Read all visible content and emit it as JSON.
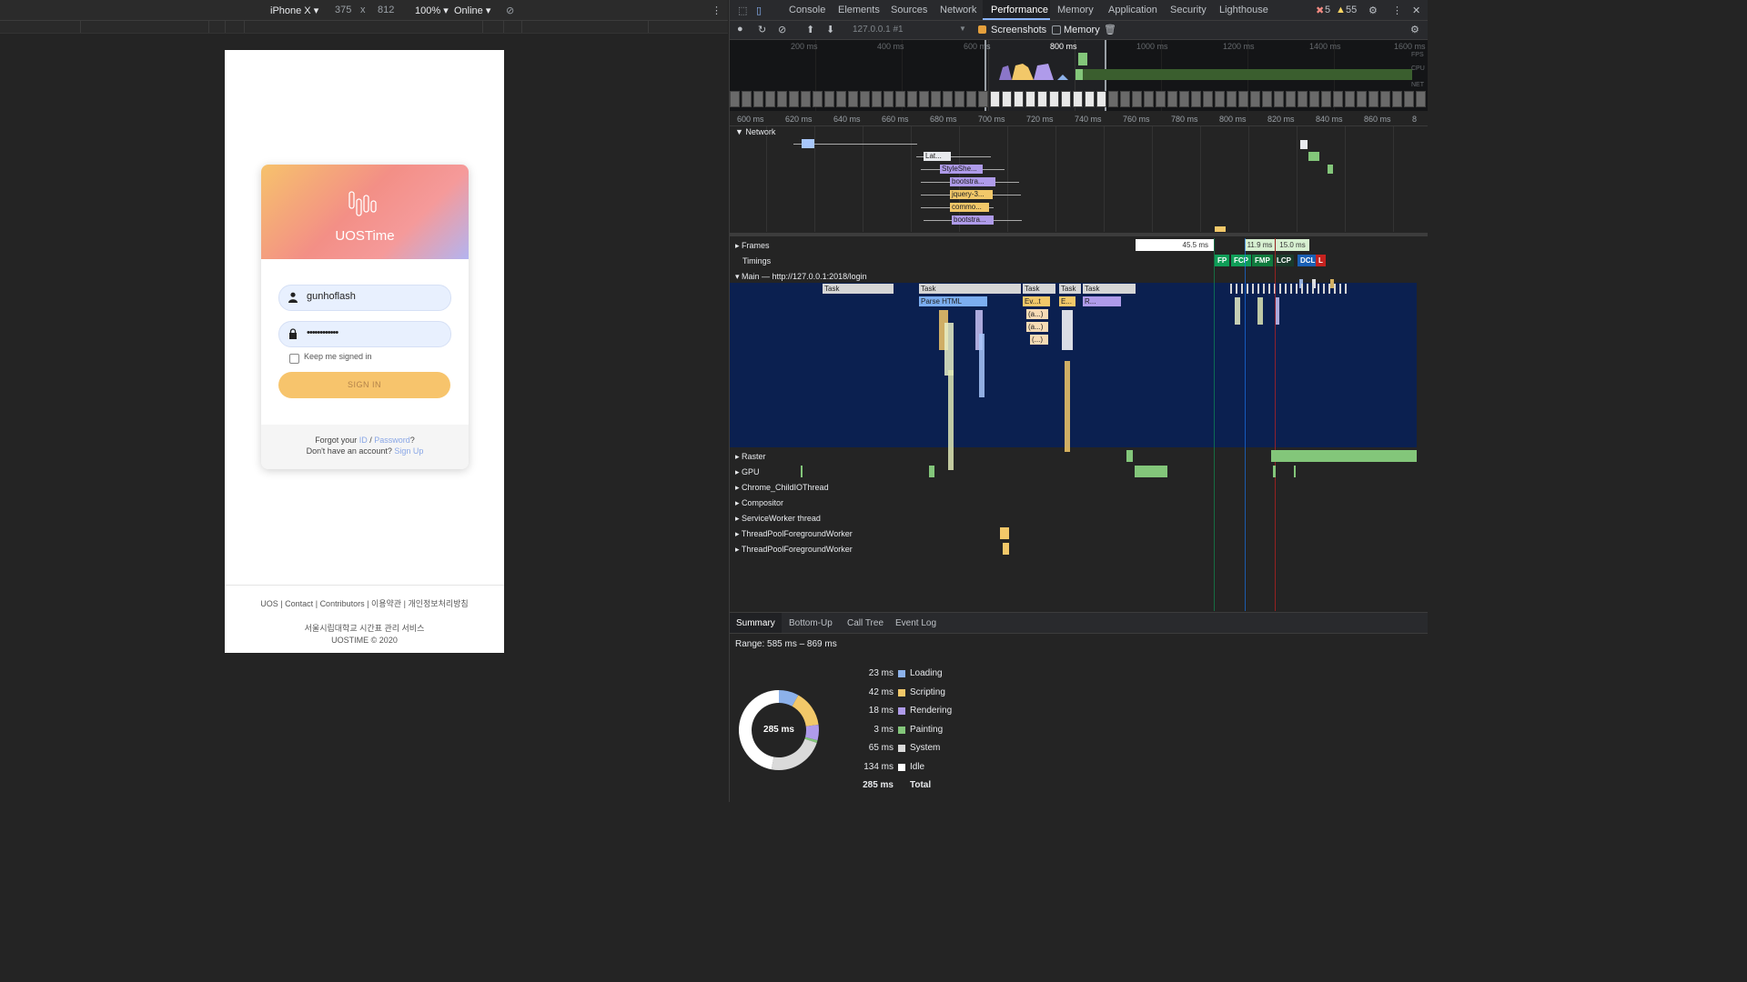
{
  "device_toolbar": {
    "device": "iPhone X ▾",
    "width": "375",
    "times": "x",
    "height": "812",
    "zoom": "100% ▾",
    "throttle": "Online ▾"
  },
  "login": {
    "brand": "UOSTime",
    "username": "gunhoflash",
    "password_mask": "••••••••••••",
    "keep_signed": "Keep me signed in",
    "signin": "SIGN IN",
    "forgot_prefix": "Forgot your",
    "forgot_id": "ID",
    "slash": "/",
    "forgot_pw": "Password",
    "qmark": "?",
    "no_account": "Don't have an account?",
    "signup": "Sign Up"
  },
  "footer": {
    "links": [
      "UOS",
      "|",
      "Contact",
      "|",
      "Contributors",
      "|",
      "이용약관",
      "|",
      "개인정보처리방침"
    ],
    "service": "서울시립대학교 시간표 관리 서비스",
    "copyright": "UOSTIME © 2020"
  },
  "devtools": {
    "tabs": [
      "Console",
      "Elements",
      "Sources",
      "Network",
      "Performance",
      "Memory",
      "Application",
      "Security",
      "Lighthouse"
    ],
    "errors": "5",
    "warnings": "55",
    "profile": "127.0.0.1 #1",
    "screenshots": "Screenshots",
    "memory": "Memory",
    "overview_ticks": [
      "200 ms",
      "400 ms",
      "600 ms",
      "800 ms",
      "1000 ms",
      "1200 ms",
      "1400 ms",
      "1600 ms"
    ],
    "overview_labels": [
      "FPS",
      "CPU",
      "NET"
    ],
    "ruler_ticks": [
      "600 ms",
      "620 ms",
      "640 ms",
      "660 ms",
      "680 ms",
      "700 ms",
      "720 ms",
      "740 ms",
      "760 ms",
      "780 ms",
      "800 ms",
      "820 ms",
      "840 ms",
      "860 ms",
      "8"
    ],
    "network_label": "Network",
    "net_requests": [
      "Lat...",
      "StyleShe...",
      "bootstra...",
      "jquery-3...",
      "commo...",
      "bootstra..."
    ],
    "frames_label": "Frames",
    "frame_times": [
      "45.5 ms",
      "11.9 ms",
      "15.0 ms"
    ],
    "timings_label": "Timings",
    "timing_markers": [
      "FP",
      "FCP",
      "FMP",
      "LCP",
      "DCL",
      "L"
    ],
    "main_label": "Main — http://127.0.0.1:2018/login",
    "flame_labels": [
      "Task",
      "Task",
      "Parse HTML",
      "Task",
      "Ev...t",
      "Task",
      "E...",
      "Task",
      "R...",
      "(a...)",
      "(a...)",
      "(...)"
    ],
    "threads": [
      "Raster",
      "GPU",
      "Chrome_ChildIOThread",
      "Compositor",
      "ServiceWorker thread",
      "ThreadPoolForegroundWorker",
      "ThreadPoolForegroundWorker"
    ],
    "bottom_tabs": [
      "Summary",
      "Bottom-Up",
      "Call Tree",
      "Event Log"
    ],
    "range": "Range: 585 ms – 869 ms",
    "donut_total": "285 ms",
    "summary": [
      {
        "value": "23 ms",
        "name": "Loading",
        "color": "#8cb1ea"
      },
      {
        "value": "42 ms",
        "name": "Scripting",
        "color": "#f2c869"
      },
      {
        "value": "18 ms",
        "name": "Rendering",
        "color": "#af9bea"
      },
      {
        "value": "3 ms",
        "name": "Painting",
        "color": "#83c67a"
      },
      {
        "value": "65 ms",
        "name": "System",
        "color": "#dadada"
      },
      {
        "value": "134 ms",
        "name": "Idle",
        "color": "#ffffff"
      },
      {
        "value": "285 ms",
        "name": "Total",
        "color": ""
      }
    ]
  }
}
